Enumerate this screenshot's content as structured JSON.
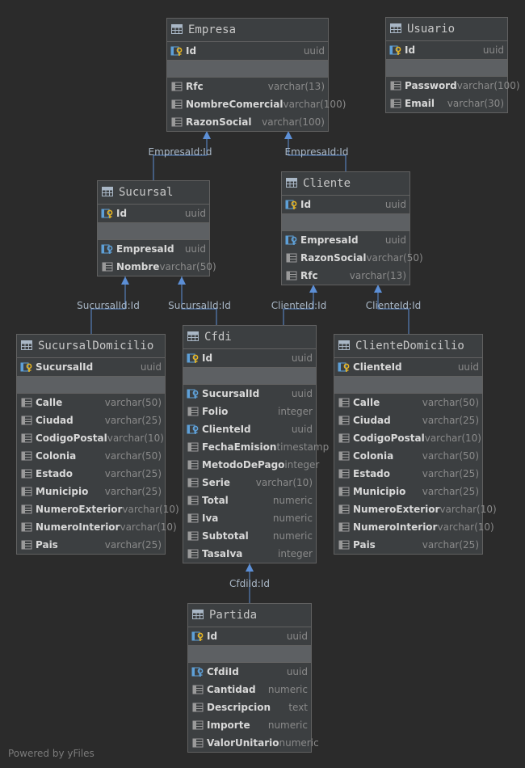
{
  "colors": {
    "background": "#2b2b2b",
    "entity_bg": "#3c3f41",
    "separator": "#5d6063",
    "link": "#5c8fd6",
    "text": "#d8d8d8",
    "type_text": "#8a8a8a"
  },
  "entities": [
    {
      "name": "Empresa",
      "icon": "table-icon",
      "pk": [
        {
          "name": "Id",
          "type": "uuid",
          "icon": "key-column-icon"
        }
      ],
      "fields": [
        {
          "name": "Rfc",
          "type": "varchar(13)",
          "icon": "column-icon"
        },
        {
          "name": "NombreComercial",
          "type": "varchar(100)",
          "icon": "column-icon"
        },
        {
          "name": "RazonSocial",
          "type": "varchar(100)",
          "icon": "column-icon"
        }
      ]
    },
    {
      "name": "Usuario",
      "icon": "table-icon",
      "pk": [
        {
          "name": "Id",
          "type": "uuid",
          "icon": "key-column-icon"
        }
      ],
      "fields": [
        {
          "name": "Password",
          "type": "varchar(100)",
          "icon": "column-icon"
        },
        {
          "name": "Email",
          "type": "varchar(30)",
          "icon": "column-icon"
        }
      ]
    },
    {
      "name": "Sucursal",
      "icon": "table-icon",
      "pk": [
        {
          "name": "Id",
          "type": "uuid",
          "icon": "key-column-icon"
        }
      ],
      "fields": [
        {
          "name": "EmpresaId",
          "type": "uuid",
          "icon": "foreign-key-icon"
        },
        {
          "name": "Nombre",
          "type": "varchar(50)",
          "icon": "column-icon"
        }
      ]
    },
    {
      "name": "Cliente",
      "icon": "table-icon",
      "pk": [
        {
          "name": "Id",
          "type": "uuid",
          "icon": "key-column-icon"
        }
      ],
      "fields": [
        {
          "name": "EmpresaId",
          "type": "uuid",
          "icon": "foreign-key-icon"
        },
        {
          "name": "RazonSocial",
          "type": "varchar(50)",
          "icon": "column-icon"
        },
        {
          "name": "Rfc",
          "type": "varchar(13)",
          "icon": "column-icon"
        }
      ]
    },
    {
      "name": "SucursalDomicilio",
      "icon": "table-icon",
      "pk": [
        {
          "name": "SucursalId",
          "type": "uuid",
          "icon": "key-column-icon"
        }
      ],
      "fields": [
        {
          "name": "Calle",
          "type": "varchar(50)",
          "icon": "column-icon"
        },
        {
          "name": "Ciudad",
          "type": "varchar(25)",
          "icon": "column-icon"
        },
        {
          "name": "CodigoPostal",
          "type": "varchar(10)",
          "icon": "column-icon"
        },
        {
          "name": "Colonia",
          "type": "varchar(50)",
          "icon": "column-icon"
        },
        {
          "name": "Estado",
          "type": "varchar(25)",
          "icon": "column-icon"
        },
        {
          "name": "Municipio",
          "type": "varchar(25)",
          "icon": "column-icon"
        },
        {
          "name": "NumeroExterior",
          "type": "varchar(10)",
          "icon": "column-icon"
        },
        {
          "name": "NumeroInterior",
          "type": "varchar(10)",
          "icon": "column-icon"
        },
        {
          "name": "Pais",
          "type": "varchar(25)",
          "icon": "column-icon"
        }
      ]
    },
    {
      "name": "Cfdi",
      "icon": "table-icon",
      "pk": [
        {
          "name": "Id",
          "type": "uuid",
          "icon": "key-column-icon"
        }
      ],
      "fields": [
        {
          "name": "SucursalId",
          "type": "uuid",
          "icon": "foreign-key-icon"
        },
        {
          "name": "Folio",
          "type": "integer",
          "icon": "column-icon"
        },
        {
          "name": "ClienteId",
          "type": "uuid",
          "icon": "foreign-key-icon"
        },
        {
          "name": "FechaEmision",
          "type": "timestamp",
          "icon": "column-icon"
        },
        {
          "name": "MetodoDePago",
          "type": "integer",
          "icon": "column-icon"
        },
        {
          "name": "Serie",
          "type": "varchar(10)",
          "icon": "column-icon"
        },
        {
          "name": "Total",
          "type": "numeric",
          "icon": "column-icon"
        },
        {
          "name": "Iva",
          "type": "numeric",
          "icon": "column-icon"
        },
        {
          "name": "Subtotal",
          "type": "numeric",
          "icon": "column-icon"
        },
        {
          "name": "TasaIva",
          "type": "integer",
          "icon": "column-icon"
        }
      ]
    },
    {
      "name": "ClienteDomicilio",
      "icon": "table-icon",
      "pk": [
        {
          "name": "ClienteId",
          "type": "uuid",
          "icon": "key-column-icon"
        }
      ],
      "fields": [
        {
          "name": "Calle",
          "type": "varchar(50)",
          "icon": "column-icon"
        },
        {
          "name": "Ciudad",
          "type": "varchar(25)",
          "icon": "column-icon"
        },
        {
          "name": "CodigoPostal",
          "type": "varchar(10)",
          "icon": "column-icon"
        },
        {
          "name": "Colonia",
          "type": "varchar(50)",
          "icon": "column-icon"
        },
        {
          "name": "Estado",
          "type": "varchar(25)",
          "icon": "column-icon"
        },
        {
          "name": "Municipio",
          "type": "varchar(25)",
          "icon": "column-icon"
        },
        {
          "name": "NumeroExterior",
          "type": "varchar(10)",
          "icon": "column-icon"
        },
        {
          "name": "NumeroInterior",
          "type": "varchar(10)",
          "icon": "column-icon"
        },
        {
          "name": "Pais",
          "type": "varchar(25)",
          "icon": "column-icon"
        }
      ]
    },
    {
      "name": "Partida",
      "icon": "table-icon",
      "pk": [
        {
          "name": "Id",
          "type": "uuid",
          "icon": "key-column-icon"
        }
      ],
      "fields": [
        {
          "name": "CfdiId",
          "type": "uuid",
          "icon": "foreign-key-icon"
        },
        {
          "name": "Cantidad",
          "type": "numeric",
          "icon": "column-icon"
        },
        {
          "name": "Descripcion",
          "type": "text",
          "icon": "column-icon"
        },
        {
          "name": "Importe",
          "type": "numeric",
          "icon": "column-icon"
        },
        {
          "name": "ValorUnitario",
          "type": "numeric",
          "icon": "column-icon"
        }
      ]
    }
  ],
  "relations": [
    {
      "from": "Sucursal",
      "to": "Empresa",
      "label": "EmpresaId:Id"
    },
    {
      "from": "Cliente",
      "to": "Empresa",
      "label": "EmpresaId:Id"
    },
    {
      "from": "SucursalDomicilio",
      "to": "Sucursal",
      "label": "SucursalId:Id"
    },
    {
      "from": "Cfdi",
      "to": "Sucursal",
      "label": "SucursalId:Id"
    },
    {
      "from": "Cfdi",
      "to": "Cliente",
      "label": "ClienteId:Id"
    },
    {
      "from": "ClienteDomicilio",
      "to": "Cliente",
      "label": "ClienteId:Id"
    },
    {
      "from": "Partida",
      "to": "Cfdi",
      "label": "CfdiId:Id"
    }
  ],
  "footer": "Powered by yFiles"
}
